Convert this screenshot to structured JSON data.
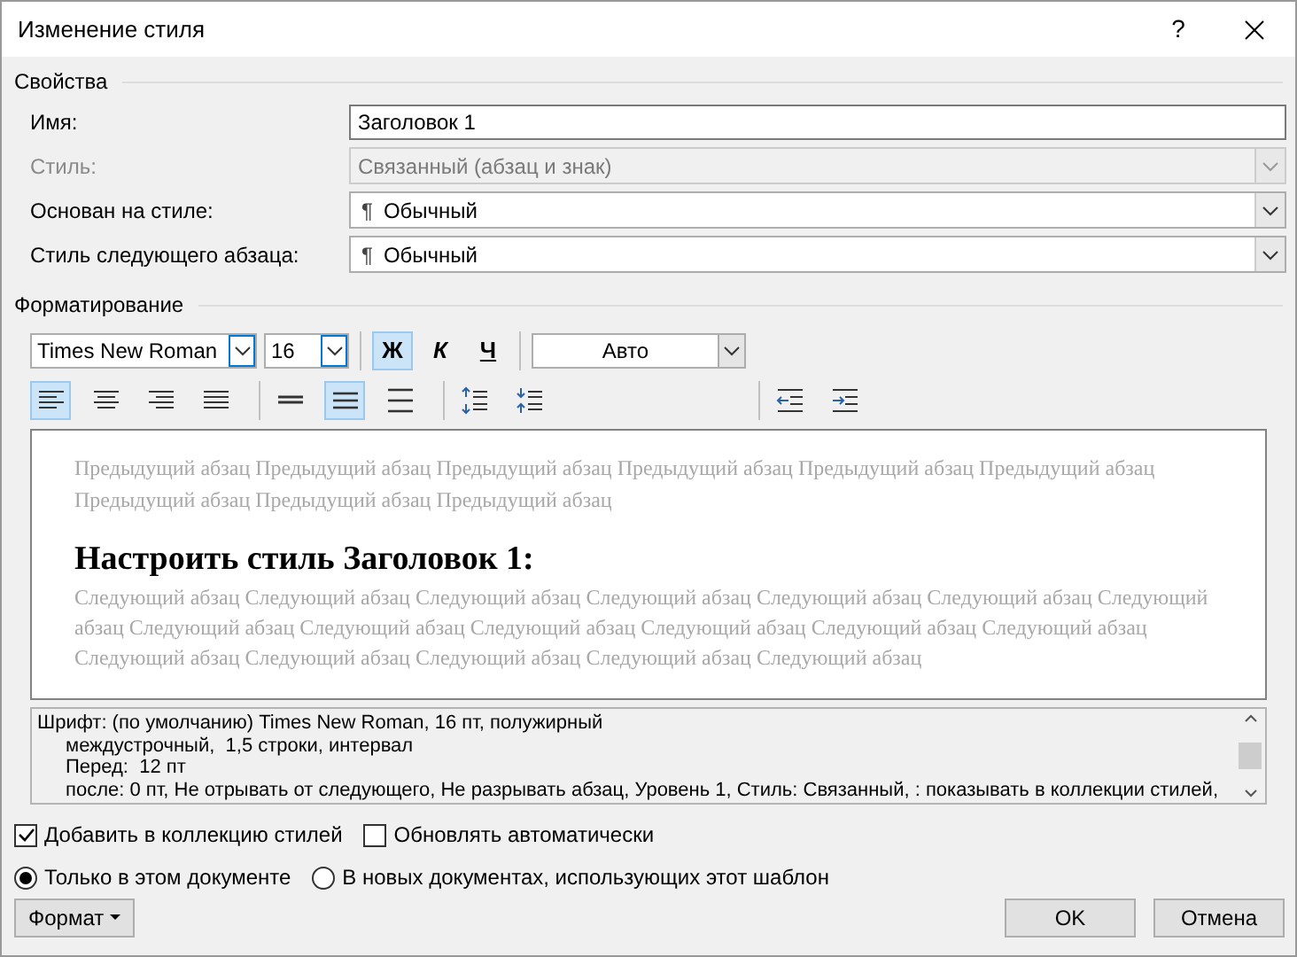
{
  "window": {
    "title": "Изменение стиля",
    "help": "?"
  },
  "properties": {
    "title": "Свойства",
    "fields": [
      {
        "label": "Имя:",
        "kind": "text",
        "value": "Заголовок 1",
        "disabled": false
      },
      {
        "label": "Стиль:",
        "kind": "select",
        "value": "Связанный (абзац и знак)",
        "disabled": true
      },
      {
        "label": "Основан на стиле:",
        "kind": "select",
        "symbol": "¶",
        "value": "Обычный",
        "disabled": false
      },
      {
        "label": "Стиль следующего абзаца:",
        "kind": "select",
        "symbol": "¶",
        "value": "Обычный",
        "disabled": false
      }
    ]
  },
  "formatting": {
    "title": "Форматирование",
    "font": "Times New Roman",
    "size": "16",
    "styles": [
      {
        "label": "Ж",
        "kind": "bold",
        "selected": true
      },
      {
        "label": "К",
        "kind": "italic",
        "selected": false
      },
      {
        "label": "Ч",
        "kind": "underline",
        "selected": false
      }
    ],
    "color_label": "Авто",
    "paragraph_buttons": [
      {
        "kind": "align-left",
        "selected": true
      },
      {
        "kind": "align-center",
        "selected": false
      },
      {
        "kind": "align-right",
        "selected": false
      },
      {
        "kind": "justify",
        "selected": false
      },
      {
        "kind": "single-spacing",
        "selected": false
      },
      {
        "kind": "one-half-spacing",
        "selected": true
      },
      {
        "kind": "double-spacing",
        "selected": false
      },
      {
        "kind": "increase-spacing",
        "selected": false
      },
      {
        "kind": "decrease-spacing",
        "selected": false
      },
      {
        "kind": "decrease-indent",
        "selected": false
      },
      {
        "kind": "increase-indent",
        "selected": false
      }
    ]
  },
  "preview": {
    "previous": "Предыдущий абзац Предыдущий абзац Предыдущий абзац Предыдущий абзац Предыдущий абзац Предыдущий абзац Предыдущий абзац Предыдущий абзац Предыдущий абзац",
    "heading": "Настроить стиль Заголовок 1:",
    "next": "Следующий абзац Следующий абзац Следующий абзац Следующий абзац Следующий абзац Следующий абзац Следующий абзац Следующий абзац Следующий абзац Следующий абзац Следующий абзац Следующий абзац Следующий абзац Следующий абзац Следующий абзац Следующий абзац Следующий абзац Следующий абзац"
  },
  "description": [
    "Шрифт: (по умолчанию) Times New Roman, 16 пт, полужирный",
    "междустрочный,  1,5 строки, интервал",
    "Перед:  12 пт",
    "после: 0 пт, Не отрывать от следующего, Не разрывать абзац, Уровень 1, Стиль: Связанный, : показывать в коллекции стилей,"
  ],
  "checkboxes": [
    {
      "label": "Добавить в коллекцию стилей",
      "checked": true
    },
    {
      "label": "Обновлять автоматически",
      "checked": false
    }
  ],
  "radios": [
    {
      "label": "Только в этом документе",
      "selected": true
    },
    {
      "label": "В новых документах, использующих этот шаблон",
      "selected": false
    }
  ],
  "buttons": {
    "format": "Формат",
    "ok": "OK",
    "cancel": "Отмена"
  }
}
